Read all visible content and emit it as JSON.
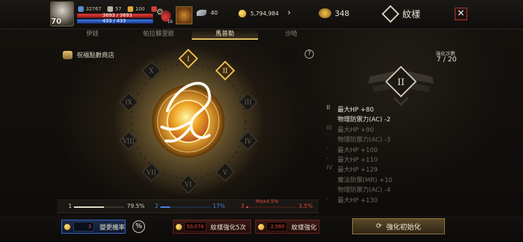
{
  "topbar": {
    "level": "70",
    "stat_a": "32767",
    "stat_b": "57",
    "stat_c": "100",
    "hp": "3693 / 3693",
    "mp": "433 / 433",
    "potion_count": "16",
    "feathers": "40",
    "gold": "5,794,984",
    "diamonds": "348",
    "menu_title": "紋樣",
    "close_label": "✕"
  },
  "tabs": [
    {
      "label": "伊娃",
      "active": false
    },
    {
      "label": "帕拉蘇里歐",
      "active": false
    },
    {
      "label": "馬普勒",
      "active": true
    },
    {
      "label": "沙哈",
      "active": false
    }
  ],
  "shop": {
    "label": "祝福點數商店"
  },
  "help_label": "?",
  "wheel": {
    "numerals": [
      "I",
      "II",
      "III",
      "IV",
      "V",
      "VI",
      "VII",
      "VIII",
      "IX",
      "X"
    ],
    "active_count": 2
  },
  "enhance": {
    "count_label": "強化次數",
    "count_value": "7 / 20",
    "crest_numeral": "II"
  },
  "stats": [
    {
      "roman": "II",
      "text": "最大HP +80",
      "state": "b"
    },
    {
      "roman": "",
      "text": "物理防禦力(AC) -2",
      "state": "b"
    },
    {
      "roman": "III",
      "text": "最大HP +90",
      "state": "d"
    },
    {
      "roman": "",
      "text": "物理防禦力(AC) -3",
      "state": "d"
    },
    {
      "roman": "-",
      "text": "最大HP +100",
      "state": "d"
    },
    {
      "roman": "-",
      "text": "最大HP +110",
      "state": "d"
    },
    {
      "roman": "IV",
      "text": "最大HP +129",
      "state": "d"
    },
    {
      "roman": "",
      "text": "魔法防禦(MR) +10",
      "state": "d"
    },
    {
      "roman": "",
      "text": "物理防禦力(AC) -4",
      "state": "d"
    },
    {
      "roman": "-",
      "text": "最大HP +130",
      "state": "d"
    }
  ],
  "statbars": [
    {
      "index": "1",
      "value": "79.5%",
      "fill": 0.6,
      "color": "#e8e2d2"
    },
    {
      "index": "2",
      "value": "17%",
      "fill": 0.2,
      "color": "#4a86e8"
    },
    {
      "index": "3",
      "value": "3.5%",
      "fill": 0.04,
      "color": "#e04a3a"
    }
  ],
  "max_label": "Max4.5%",
  "buttons": {
    "prob_cost": "3",
    "prob_label": "變更機率",
    "pct_label": "%",
    "enhance5_cost": "50,074",
    "enhance5_label": "紋樣強化5次",
    "enhance_cost": "2,560",
    "enhance_label": "紋樣強化",
    "reset_label": "強化初始化"
  },
  "colors": {
    "accent_gold": "#e9c66b",
    "hp_red": "#e0413b",
    "mp_blue": "#3f7ae0",
    "cost_red": "#e34a3a"
  }
}
